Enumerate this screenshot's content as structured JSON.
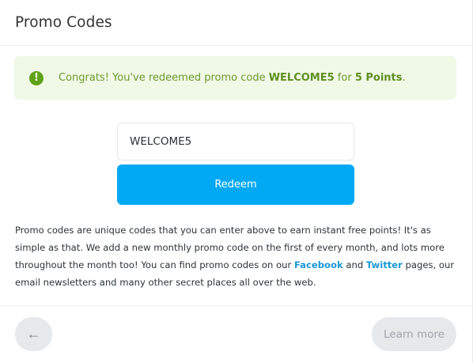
{
  "modal": {
    "title": "Promo Codes"
  },
  "alert": {
    "icon": "exclamation-circle-icon",
    "text_before": "Congrats! You've redeemed promo code ",
    "code": "WELCOME5",
    "text_middle": " for ",
    "points": "5 Points",
    "text_after": "."
  },
  "form": {
    "code_value": "WELCOME5",
    "redeem_label": "Redeem"
  },
  "description": {
    "part1": "Promo codes are unique codes that you can enter above to earn instant free points! It's as simple as that. We add a new monthly promo code on the first of every month, and lots more throughout the month too! You can find promo codes on our ",
    "facebook_link": "Facebook",
    "part2": " and ",
    "twitter_link": "Twitter",
    "part3": " pages, our email newsletters and many other secret places all over the web."
  },
  "footer": {
    "back_icon": "arrow-left-icon",
    "back_glyph": "←",
    "learn_more_label": "Learn more"
  },
  "colors": {
    "accent": "#01a9f4",
    "success_bg": "#f0f8e6",
    "success_text": "#6b9a2c",
    "success_icon": "#5fa218",
    "link": "#1a97d5"
  }
}
